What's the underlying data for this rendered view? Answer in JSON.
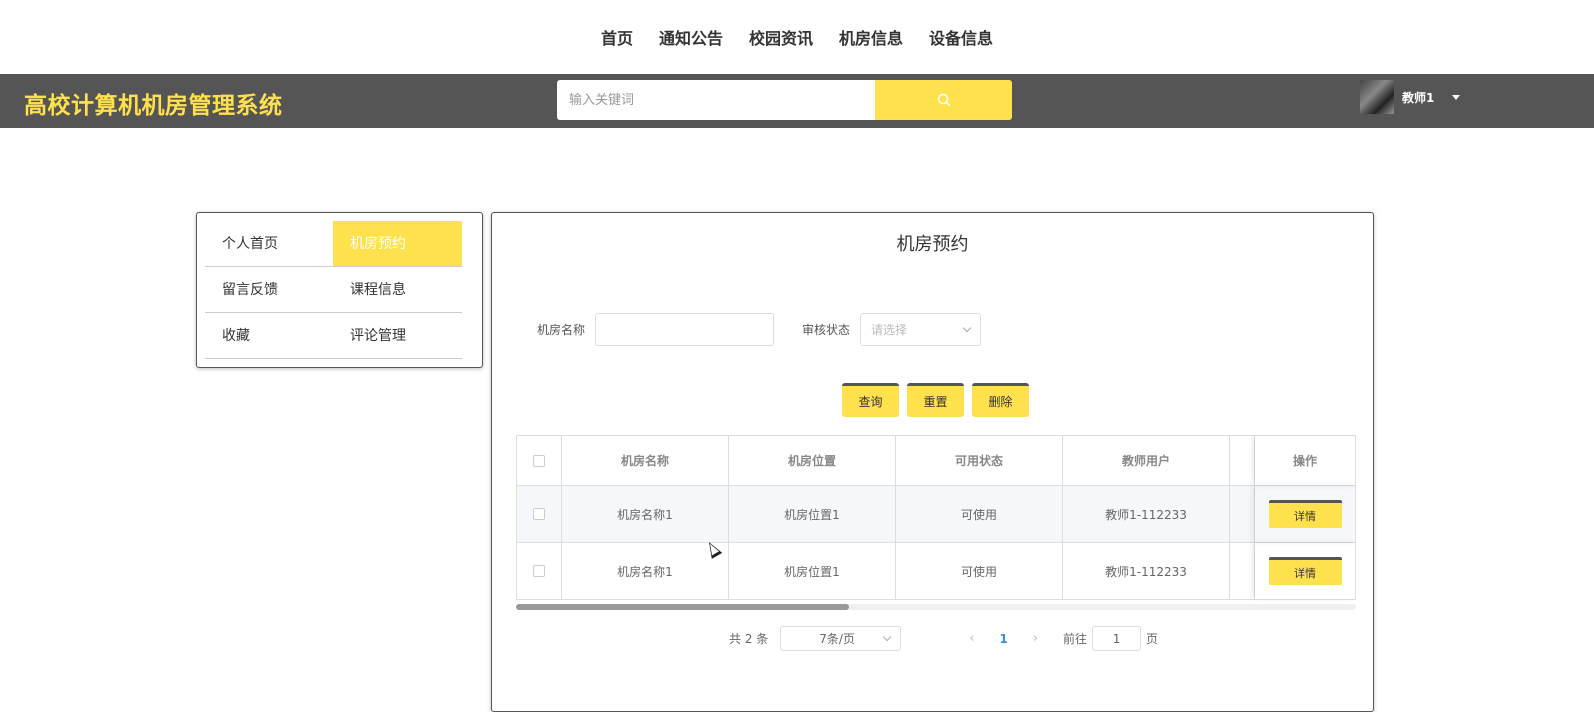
{
  "topnav": [
    "首页",
    "通知公告",
    "校园资讯",
    "机房信息",
    "设备信息"
  ],
  "header": {
    "logo": "高校计算机机房管理系统",
    "search_placeholder": "输入关键词",
    "user_name": "教师1"
  },
  "sidemenu": {
    "items": [
      {
        "label": "个人首页",
        "active": false
      },
      {
        "label": "机房预约",
        "active": true
      },
      {
        "label": "留言反馈",
        "active": false
      },
      {
        "label": "课程信息",
        "active": false
      },
      {
        "label": "收藏",
        "active": false
      },
      {
        "label": "评论管理",
        "active": false
      }
    ]
  },
  "main": {
    "title": "机房预约",
    "filter": {
      "name_label": "机房名称",
      "name_value": "",
      "status_label": "审核状态",
      "status_placeholder": "请选择"
    },
    "buttons": {
      "query": "查询",
      "reset": "重置",
      "delete": "删除"
    },
    "table": {
      "headers": [
        "机房名称",
        "机房位置",
        "可用状态",
        "教师用户",
        "操作"
      ],
      "rows": [
        {
          "name": "机房名称1",
          "location": "机房位置1",
          "status": "可使用",
          "teacher": "教师1-112233",
          "action": "详情"
        },
        {
          "name": "机房名称1",
          "location": "机房位置1",
          "status": "可使用",
          "teacher": "教师1-112233",
          "action": "详情"
        }
      ]
    },
    "pager": {
      "total": "共 2 条",
      "page_size": "7条/页",
      "current": "1",
      "goto_prefix": "前往",
      "goto_value": "1",
      "goto_suffix": "页"
    }
  },
  "colors": {
    "accent": "#ffe14d",
    "header_bg": "#555555"
  },
  "icons": {
    "search": "search-icon",
    "caret": "caret-down-icon"
  }
}
